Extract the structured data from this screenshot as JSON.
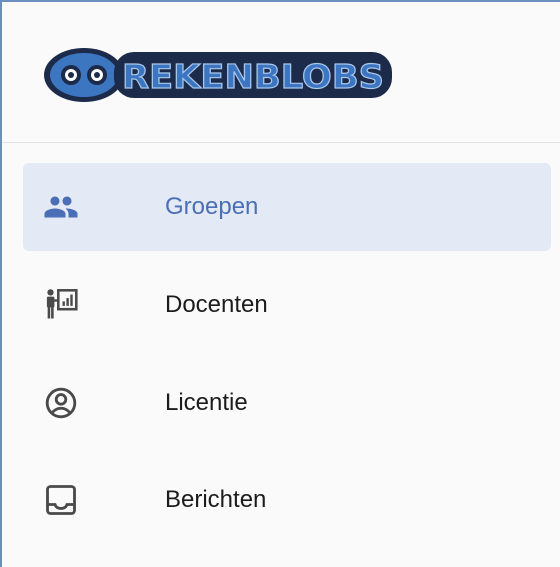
{
  "brand": {
    "name": "REKENBLOBS",
    "logo_icon": "blob-eyes-icon",
    "colors": {
      "outline": "#1d2b4a",
      "fill": "#3c76c0",
      "highlight": "#a9c6ec"
    }
  },
  "sidebar": {
    "items": [
      {
        "label": "Groepen",
        "icon": "groups-icon",
        "active": true
      },
      {
        "label": "Docenten",
        "icon": "teacher-icon",
        "active": false
      },
      {
        "label": "Licentie",
        "icon": "account-circle-icon",
        "active": false
      },
      {
        "label": "Berichten",
        "icon": "inbox-icon",
        "active": false
      }
    ]
  },
  "colors": {
    "active_background": "#e3e9f5",
    "active_text": "#4a6fb6",
    "text": "#1c1c1c",
    "icon": "#4a4a4a",
    "frame_border": "#6b8fbf"
  }
}
